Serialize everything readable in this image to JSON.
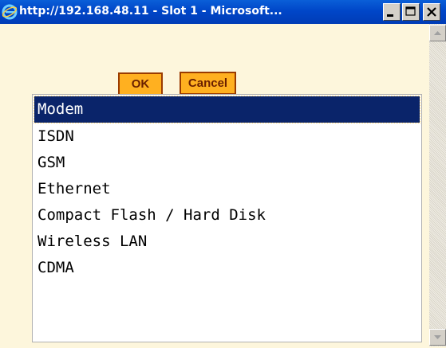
{
  "window": {
    "title": "http://192.168.48.11 - Slot 1 - Microsoft..."
  },
  "buttons": {
    "ok_label": "OK",
    "cancel_label": "Cancel"
  },
  "list": {
    "selected_index": 0,
    "items": [
      {
        "label": "Modem"
      },
      {
        "label": "ISDN"
      },
      {
        "label": "GSM"
      },
      {
        "label": "Ethernet"
      },
      {
        "label": "Compact Flash / Hard Disk"
      },
      {
        "label": "Wireless LAN"
      },
      {
        "label": "CDMA"
      }
    ]
  },
  "colors": {
    "titlebar": "#0046c8",
    "button_fill": "#ffb020",
    "selection": "#0a246a",
    "background": "#fdf6dc"
  },
  "icons": {
    "title": "internet-explorer-icon",
    "minimize": "minimize-icon",
    "maximize": "maximize-icon",
    "close": "close-icon"
  }
}
